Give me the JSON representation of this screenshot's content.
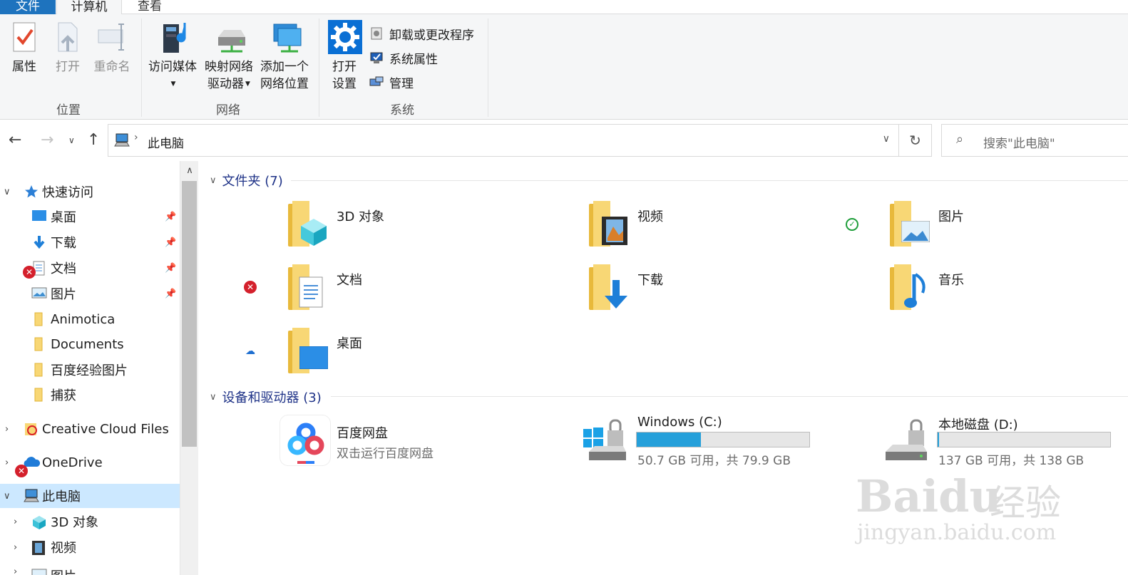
{
  "tabs": {
    "file": "文件",
    "computer": "计算机",
    "view": "查看"
  },
  "ribbon": {
    "location": {
      "label": "位置",
      "properties": "属性",
      "open": "打开",
      "rename": "重命名"
    },
    "network": {
      "label": "网络",
      "access_media": "访问媒体",
      "map_drive_1": "映射网络",
      "map_drive_2": "驱动器",
      "add_location_1": "添加一个",
      "add_location_2": "网络位置"
    },
    "system": {
      "label": "系统",
      "open_settings_1": "打开",
      "open_settings_2": "设置",
      "uninstall": "卸载或更改程序",
      "system_properties": "系统属性",
      "manage": "管理"
    }
  },
  "address": {
    "path": "此电脑",
    "search_placeholder": "搜索\"此电脑\""
  },
  "navpane": {
    "quick_access": "快速访问",
    "items": [
      {
        "label": "桌面",
        "pinned": true
      },
      {
        "label": "下载",
        "pinned": true
      },
      {
        "label": "文档",
        "pinned": true
      },
      {
        "label": "图片",
        "pinned": true
      },
      {
        "label": "Animotica"
      },
      {
        "label": "Documents"
      },
      {
        "label": "百度经验图片"
      },
      {
        "label": "捕获"
      }
    ],
    "creative_cloud": "Creative Cloud Files",
    "onedrive": "OneDrive",
    "this_pc": "此电脑",
    "pc_items": [
      "3D 对象",
      "视频",
      "图片"
    ]
  },
  "content": {
    "folders_header": "文件夹 (7)",
    "folders": [
      {
        "name": "3D 对象"
      },
      {
        "name": "视频"
      },
      {
        "name": "图片"
      },
      {
        "name": "文档"
      },
      {
        "name": "下载"
      },
      {
        "name": "音乐"
      },
      {
        "name": "桌面"
      }
    ],
    "devices_header": "设备和驱动器 (3)",
    "devices": [
      {
        "name": "百度网盘",
        "sub": "双击运行百度网盘"
      },
      {
        "name": "Windows (C:)",
        "sub": "50.7 GB 可用，共 79.9 GB",
        "used_fraction": 0.37
      },
      {
        "name": "本地磁盘 (D:)",
        "sub": "137 GB 可用，共 138 GB",
        "used_fraction": 0.01
      }
    ]
  },
  "watermark": {
    "brand": "Baidu",
    "brand_cn": "经验",
    "site": "jingyan.baidu.com"
  },
  "colors": {
    "accent": "#1e73be",
    "selection": "#cce8ff",
    "folder": "#f8d775",
    "drive_fill": "#26a0da"
  }
}
